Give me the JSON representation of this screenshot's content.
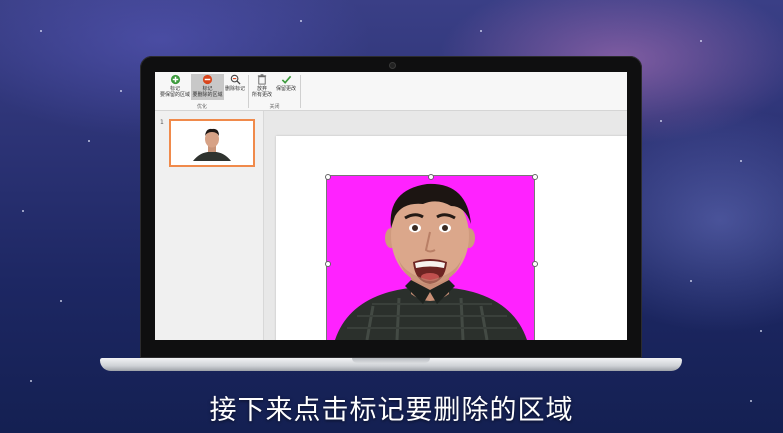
{
  "ribbon": {
    "mark_keep": {
      "line1": "标记",
      "line2": "要保留的区域"
    },
    "mark_remove": {
      "line1": "标记",
      "line2": "要删除的区域"
    },
    "delete_mark": "删除标记",
    "discard_all": {
      "line1": "放弃",
      "line2": "所有更改"
    },
    "keep_changes": "保留更改",
    "group_refine": "优化",
    "group_close": "关闭"
  },
  "thumbnails": {
    "slide_number": "1"
  },
  "subtitle": "接下来点击标记要删除的区域",
  "colors": {
    "selection_border": "#f08a4b",
    "photo_background": "#ff22ff"
  },
  "icons": [
    "plus-circle-icon",
    "minus-circle-icon",
    "eraser-icon",
    "discard-icon",
    "checkmark-icon"
  ]
}
